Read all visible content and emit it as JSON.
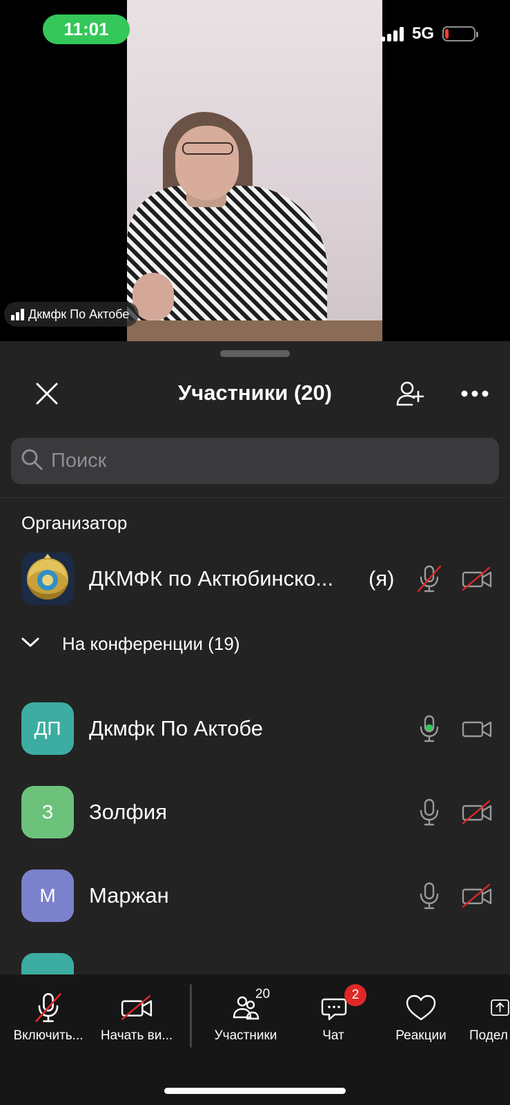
{
  "status_bar": {
    "time": "11:01",
    "network": "5G",
    "battery_level": 0.12,
    "battery_color": "#ff3b30",
    "time_pill_color": "#34c759"
  },
  "video": {
    "speaker_name": "Дкмфк По Актобе"
  },
  "participants_panel": {
    "title": "Участники (20)",
    "close_icon": "close-icon",
    "invite_icon": "add-person-icon",
    "more_icon": "more-dots-icon",
    "search": {
      "placeholder": "Поиск",
      "value": ""
    },
    "host_section": {
      "label": "Организатор",
      "host": {
        "name": "ДКМФК по Актюбинско...",
        "you_label": "(я)",
        "avatar_icon": "emblem-icon",
        "mic": "muted",
        "camera": "off"
      }
    },
    "in_meeting": {
      "label": "На конференции (19)",
      "expanded": true,
      "participants": [
        {
          "initials": "ДП",
          "name": "Дкмфк По Актобе",
          "avatar_color": "#3dada2",
          "mic": "active",
          "camera": "on"
        },
        {
          "initials": "З",
          "name": "Золфия",
          "avatar_color": "#6cc27a",
          "mic": "on",
          "camera": "off"
        },
        {
          "initials": "М",
          "name": "Маржан",
          "avatar_color": "#7b82cc",
          "mic": "on",
          "camera": "off"
        }
      ]
    }
  },
  "toolbar": {
    "items": [
      {
        "label": "Включить...",
        "icon": "mic-muted-icon"
      },
      {
        "label": "Начать ви...",
        "icon": "video-off-icon"
      },
      {
        "label": "Участники",
        "icon": "participants-icon",
        "count": "20"
      },
      {
        "label": "Чат",
        "icon": "chat-icon",
        "badge": "2"
      },
      {
        "label": "Реакции",
        "icon": "heart-icon"
      },
      {
        "label": "Подел",
        "icon": "share-icon"
      }
    ]
  },
  "colors": {
    "sheet_background": "#232323",
    "toolbar_background": "#161616",
    "muted_red": "#e02828",
    "active_green": "#34c759"
  }
}
